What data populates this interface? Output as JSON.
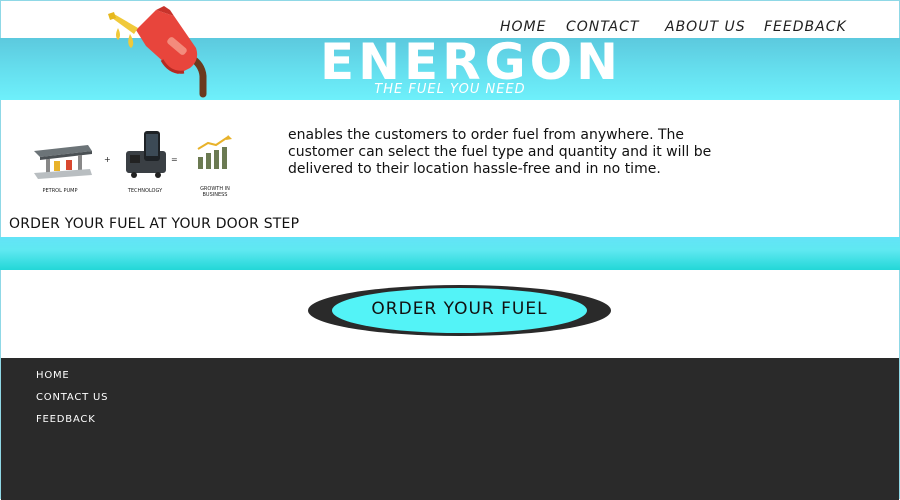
{
  "nav": {
    "home": "HOME",
    "contact": "CONTACT",
    "about": "ABOUT US",
    "feedback": "FEEDBACK"
  },
  "header": {
    "brand": "ENERGON",
    "tagline": "THE FUEL YOU NEED"
  },
  "intro": {
    "captions": [
      "PETROL PUMP",
      "TECHNOLOGY",
      "GROWTH IN BUSINESS"
    ],
    "operators": [
      "+",
      "="
    ],
    "description": " enables the customers to order fuel from anywhere. The customer can select the fuel type and quantity and it will be delivered to their location hassle-free and in no time.",
    "doorstep": "ORDER YOUR FUEL AT YOUR DOOR STEP"
  },
  "cta": {
    "label": "ORDER YOUR FUEL"
  },
  "footer": {
    "links": [
      "HOME",
      "CONTACT US",
      "FEEDBACK"
    ]
  },
  "colors": {
    "banner": "#64dcec",
    "cta_fill": "#53f3f7",
    "footer_bg": "#2a2a2a",
    "pump_red": "#e8453c"
  },
  "icons": {
    "logo": "fuel-nozzle-icon",
    "intro": [
      "petrol-pump-icon",
      "smartphone-icon",
      "growth-chart-icon"
    ]
  }
}
